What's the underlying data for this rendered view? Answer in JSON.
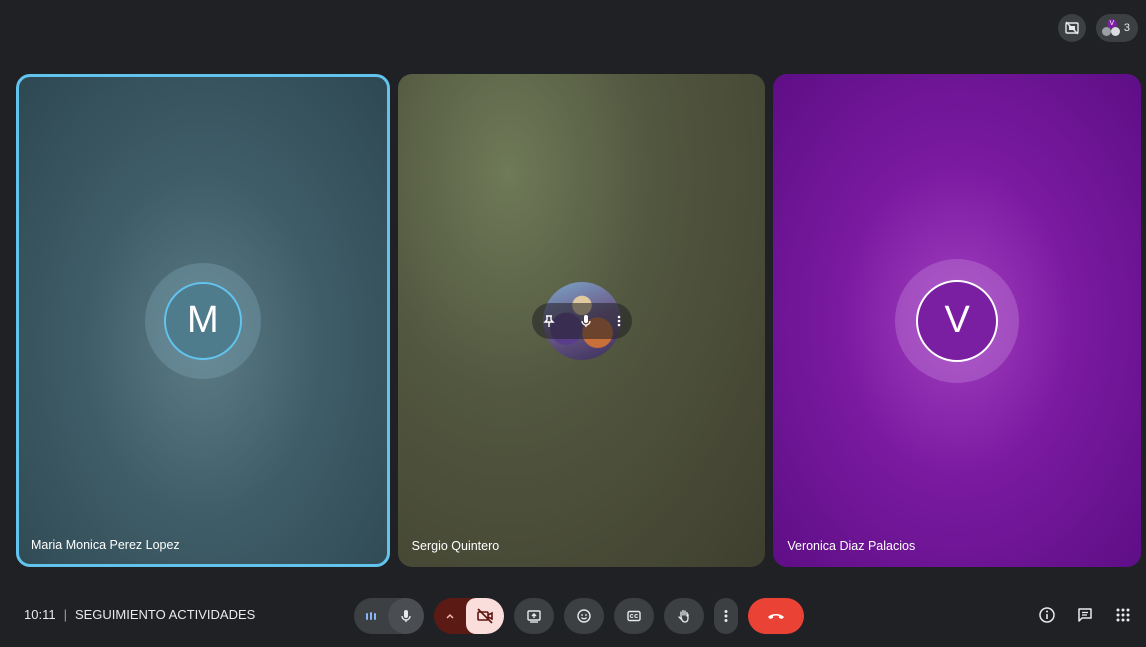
{
  "top_bar": {
    "participant_count": "3",
    "people_avatar_initial": "V"
  },
  "participants": [
    {
      "name": "Maria Monica Perez Lopez",
      "initial": "M",
      "color": "#4e7c8c",
      "active_speaker": true
    },
    {
      "name": "Sergio Quintero",
      "initial": "",
      "has_photo": true
    },
    {
      "name": "Veronica Diaz Palacios",
      "initial": "V",
      "color": "#7b1fa2"
    }
  ],
  "meeting": {
    "time": "10:11",
    "separator": "|",
    "title": "SEGUIMIENTO ACTIVIDADES"
  },
  "colors": {
    "active_border": "#62c3ee",
    "end_call": "#ea4335",
    "cam_off_bg": "#f9dedc"
  },
  "icons": {
    "camera_hidden": "camera-off-grid-icon",
    "audio_levels": "audio-level-icon",
    "mic": "mic-icon",
    "chevron": "chevron-up-icon",
    "camera_off": "videocam-off-icon",
    "present": "present-screen-icon",
    "emoji": "emoji-icon",
    "captions": "captions-icon",
    "raise_hand": "raise-hand-icon",
    "more": "more-vert-icon",
    "end_call": "call-end-icon",
    "info": "info-icon",
    "chat": "chat-icon",
    "activities": "apps-grid-icon",
    "pin": "pin-icon"
  }
}
